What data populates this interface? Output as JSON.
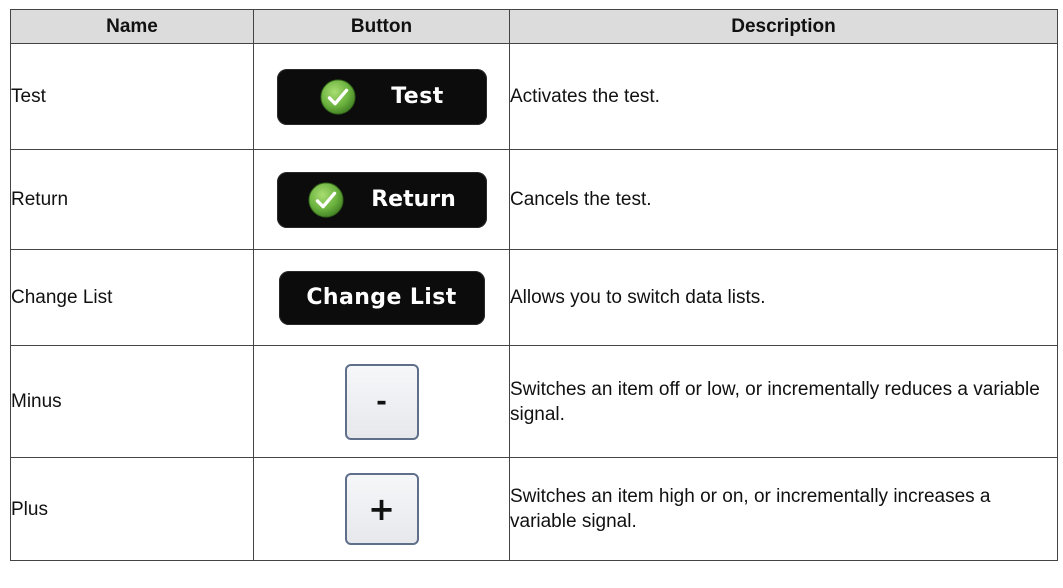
{
  "table": {
    "headers": {
      "name": "Name",
      "button": "Button",
      "description": "Description"
    },
    "rows": [
      {
        "name": "Test",
        "button_label": "Test",
        "button_icon": "check-icon",
        "description": "Activates the test."
      },
      {
        "name": "Return",
        "button_label": "Return",
        "button_icon": "check-icon",
        "description": "Cancels the test."
      },
      {
        "name": "Change List",
        "button_label": "Change List",
        "description": "Allows you to switch data lists."
      },
      {
        "name": "Minus",
        "button_label": "-",
        "description": "Switches an item off or low, or incrementally reduces a variable signal."
      },
      {
        "name": "Plus",
        "button_label": "+",
        "description": "Switches an item high or on, or incrementally increases a variable signal."
      }
    ]
  },
  "colors": {
    "header_bg": "#dcdcdc",
    "button_black": "#0c0c0c",
    "check_green": "#6cb33f",
    "square_border": "#5f6f8a"
  }
}
